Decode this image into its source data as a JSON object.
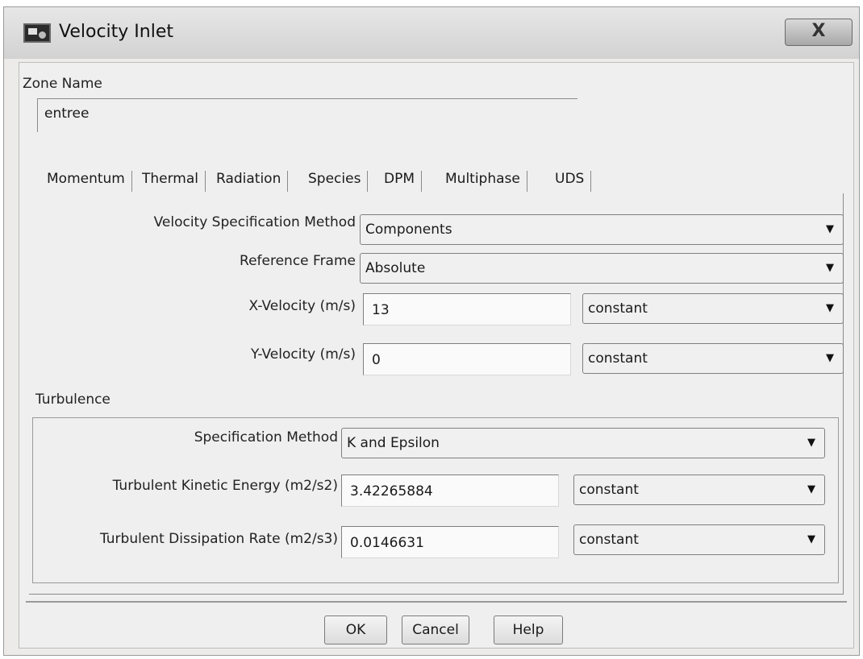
{
  "window": {
    "title": "Velocity Inlet",
    "close_label": "X"
  },
  "zone": {
    "label": "Zone Name",
    "value": "entree"
  },
  "tabs": [
    {
      "label": "Momentum"
    },
    {
      "label": "Thermal"
    },
    {
      "label": "Radiation"
    },
    {
      "label": "Species"
    },
    {
      "label": "DPM"
    },
    {
      "label": "Multiphase"
    },
    {
      "label": "UDS"
    }
  ],
  "momentum": {
    "velocity_method_label": "Velocity Specification Method",
    "velocity_method_value": "Components",
    "reference_frame_label": "Reference Frame",
    "reference_frame_value": "Absolute",
    "x_velocity_label": "X-Velocity (m/s)",
    "x_velocity_value": "13",
    "x_velocity_profile": "constant",
    "y_velocity_label": "Y-Velocity (m/s)",
    "y_velocity_value": "0",
    "y_velocity_profile": "constant"
  },
  "turbulence": {
    "group_label": "Turbulence",
    "method_label": "Specification Method",
    "method_value": "K and Epsilon",
    "tke_label": "Turbulent Kinetic Energy (m2/s2)",
    "tke_value": "3.42265884",
    "tke_profile": "constant",
    "tdr_label": "Turbulent Dissipation Rate (m2/s3)",
    "tdr_value": "0.0146631",
    "tdr_profile": "constant"
  },
  "buttons": {
    "ok": "OK",
    "cancel": "Cancel",
    "help": "Help"
  },
  "icons": {
    "dropdown": "chevron-down-icon",
    "app": "fluent-window-icon"
  }
}
